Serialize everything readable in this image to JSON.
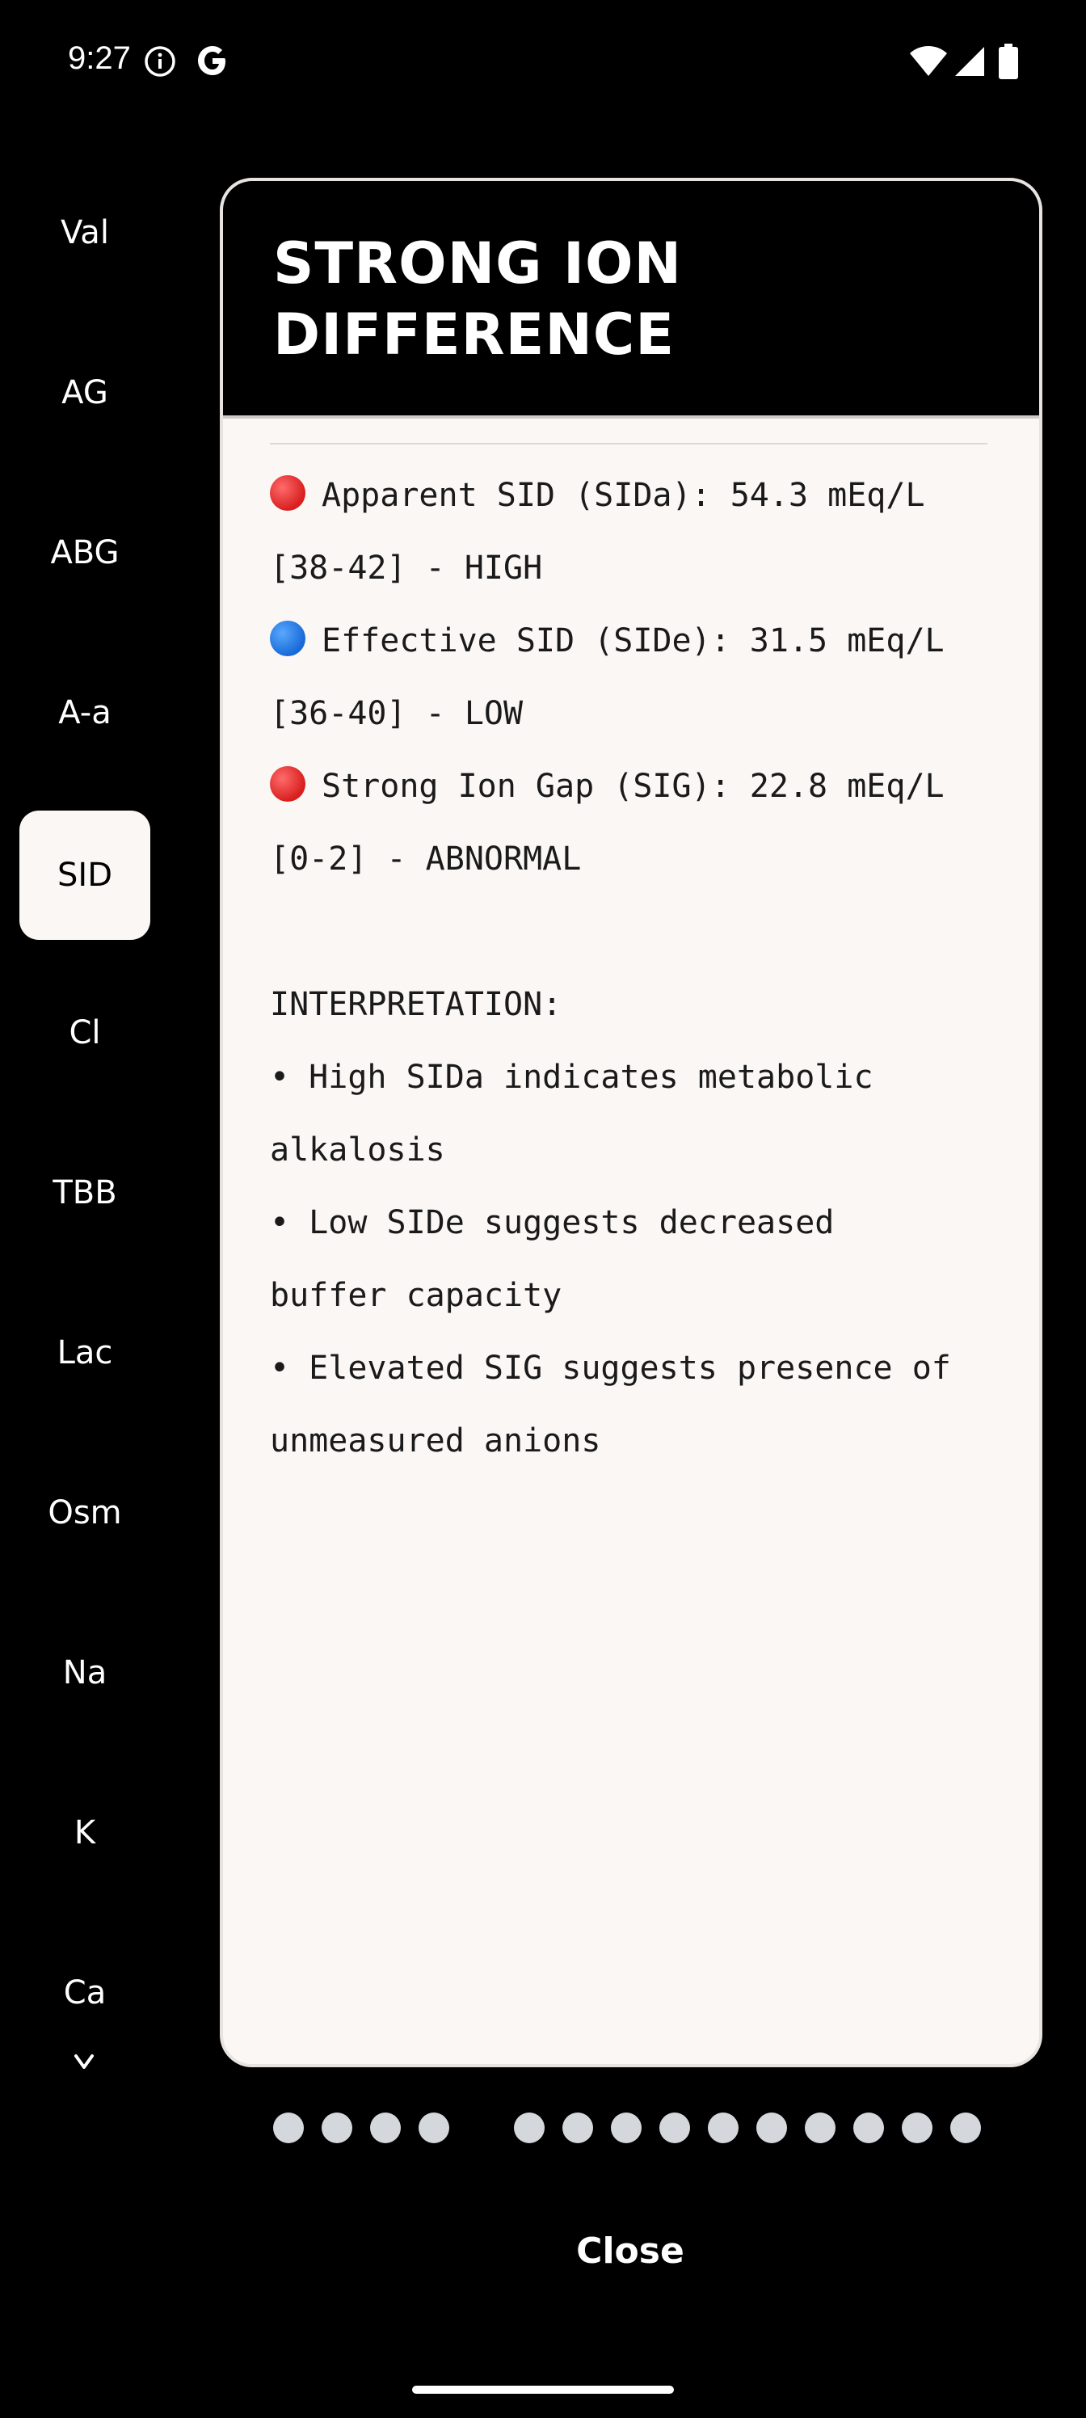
{
  "status_bar": {
    "time": "9:27",
    "icons": [
      "info-icon",
      "google-g-icon",
      "wifi-icon",
      "signal-icon",
      "battery-icon"
    ]
  },
  "sidebar": {
    "items": [
      {
        "label": "Val",
        "active": false
      },
      {
        "label": "AG",
        "active": false
      },
      {
        "label": "ABG",
        "active": false
      },
      {
        "label": "A-a",
        "active": false
      },
      {
        "label": "SID",
        "active": true
      },
      {
        "label": "Cl",
        "active": false
      },
      {
        "label": "TBB",
        "active": false
      },
      {
        "label": "Lac",
        "active": false
      },
      {
        "label": "Osm",
        "active": false
      },
      {
        "label": "Na",
        "active": false
      },
      {
        "label": "K",
        "active": false
      },
      {
        "label": "Ca",
        "active": false
      }
    ],
    "more_icon": "chevron-down-icon"
  },
  "card": {
    "title_line1": "STRONG ION",
    "title_line2": "DIFFERENCE",
    "lines": [
      {
        "dot": "red",
        "text": "Apparent SID (SIDa): 54.3 mEq/L"
      },
      {
        "dot": "",
        "text": "[38-42] - HIGH"
      },
      {
        "dot": "blue",
        "text": "Effective SID (SIDe): 31.5 mEq/L"
      },
      {
        "dot": "",
        "text": "[36-40] - LOW"
      },
      {
        "dot": "red",
        "text": "Strong Ion Gap (SIG): 22.8 mEq/L"
      },
      {
        "dot": "",
        "text": "[0-2] - ABNORMAL"
      },
      {
        "dot": "",
        "text": ""
      },
      {
        "dot": "",
        "text": "INTERPRETATION:"
      },
      {
        "dot": "",
        "text": "• High SIDa indicates metabolic"
      },
      {
        "dot": "",
        "text": "alkalosis"
      },
      {
        "dot": "",
        "text": "• Low SIDe suggests decreased"
      },
      {
        "dot": "",
        "text": "buffer capacity"
      },
      {
        "dot": "",
        "text": "• Elevated SIG suggests presence of"
      },
      {
        "dot": "",
        "text": "unmeasured anions"
      }
    ],
    "colors": {
      "red_dot": "#d81e1e",
      "blue_dot": "#1769d6",
      "card_bg": "#faf7f5"
    }
  },
  "pager": {
    "groups": [
      4,
      10
    ]
  },
  "close_label": "Close"
}
